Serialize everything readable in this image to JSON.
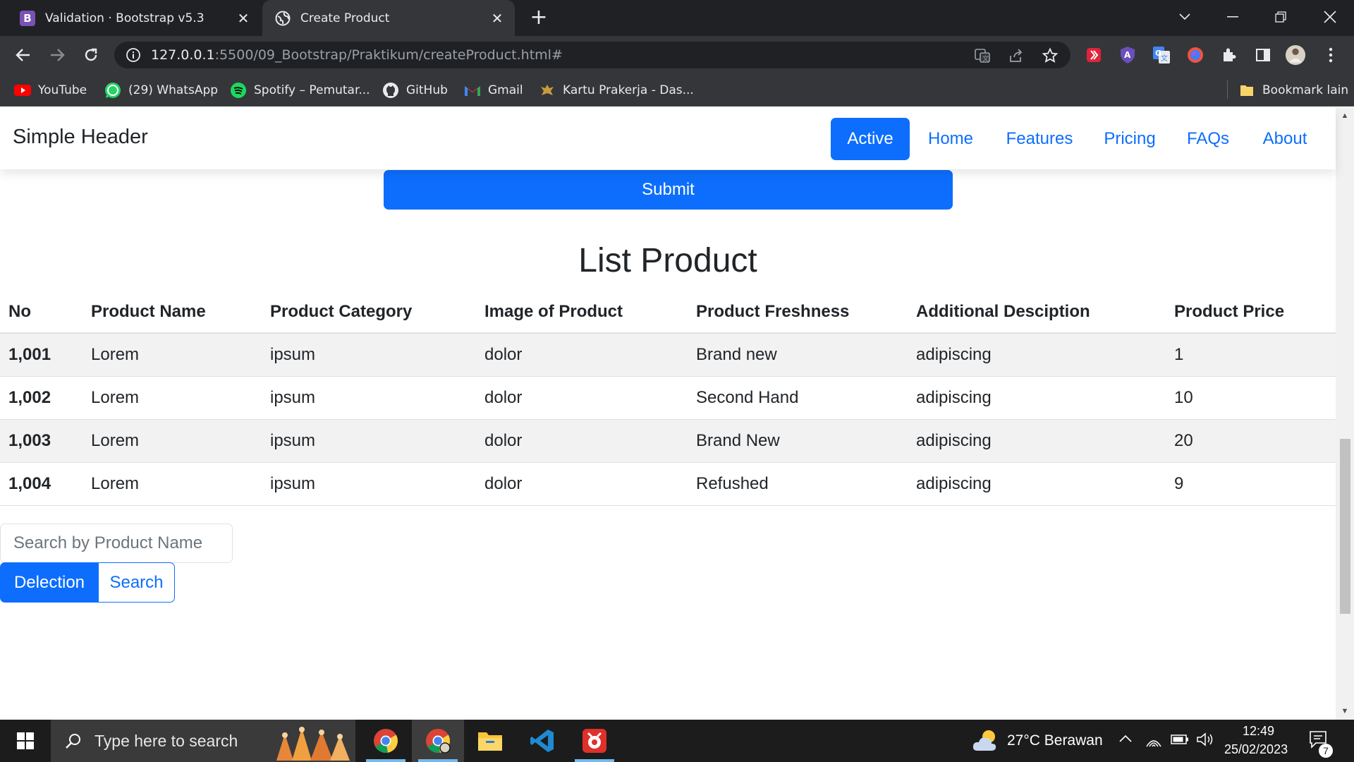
{
  "browser": {
    "tabs": [
      {
        "title": "Validation · Bootstrap v5.3",
        "favicon": "bootstrap-icon"
      },
      {
        "title": "Create Product",
        "favicon": "globe-icon"
      }
    ],
    "url_host": "127.0.0.1",
    "url_rest": ":5500/09_Bootstrap/Praktikum/createProduct.html#",
    "bookmarks": [
      {
        "label": "YouTube",
        "icon": "youtube-icon"
      },
      {
        "label": "(29) WhatsApp",
        "icon": "whatsapp-icon"
      },
      {
        "label": "Spotify – Pemutar...",
        "icon": "spotify-icon"
      },
      {
        "label": "GitHub",
        "icon": "github-icon"
      },
      {
        "label": "Gmail",
        "icon": "gmail-icon"
      },
      {
        "label": "Kartu Prakerja - Das...",
        "icon": "prakerja-icon"
      }
    ],
    "other_bookmarks": "Bookmark lain"
  },
  "navbar": {
    "brand": "Simple Header",
    "links": [
      "Active",
      "Home",
      "Features",
      "Pricing",
      "FAQs",
      "About"
    ],
    "active_index": 0
  },
  "form": {
    "submit_label": "Submit"
  },
  "list": {
    "title": "List Product",
    "headers": [
      "No",
      "Product Name",
      "Product Category",
      "Image of Product",
      "Product Freshness",
      "Additional Desciption",
      "Product Price"
    ],
    "rows": [
      [
        "1,001",
        "Lorem",
        "ipsum",
        "dolor",
        "Brand new",
        "adipiscing",
        "1"
      ],
      [
        "1,002",
        "Lorem",
        "ipsum",
        "dolor",
        "Second Hand",
        "adipiscing",
        "10"
      ],
      [
        "1,003",
        "Lorem",
        "ipsum",
        "dolor",
        "Brand New",
        "adipiscing",
        "20"
      ],
      [
        "1,004",
        "Lorem",
        "ipsum",
        "dolor",
        "Refushed",
        "adipiscing",
        "9"
      ]
    ]
  },
  "search": {
    "placeholder": "Search by Product Name",
    "delection_label": "Delection",
    "search_label": "Search"
  },
  "taskbar": {
    "search_placeholder": "Type here to search",
    "weather": "27°C  Berawan",
    "time": "12:49",
    "date": "25/02/2023",
    "notification_count": "7"
  },
  "colors": {
    "primary": "#0d6efd",
    "chrome_dark": "#202124",
    "chrome_toolbar": "#35363a"
  }
}
